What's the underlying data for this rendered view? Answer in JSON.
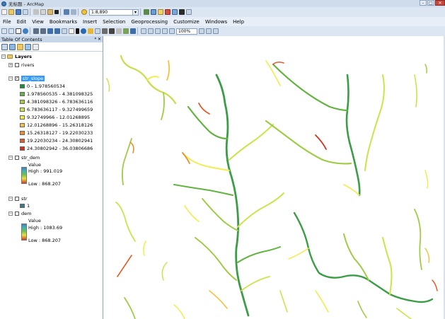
{
  "window": {
    "title": "无标题 - ArcMap"
  },
  "toolbar": {
    "scale": "1:8,890",
    "zoom": "100%"
  },
  "menu": [
    "File",
    "Edit",
    "View",
    "Bookmarks",
    "Insert",
    "Selection",
    "Geoprocessing",
    "Customize",
    "Windows",
    "Help"
  ],
  "toc": {
    "title": "Table Of Contents",
    "header_buttons": "ᵠ ✕",
    "layers_label": "Layers",
    "rivers": "rivers",
    "str_slope": "str_slope",
    "slope_classes": [
      {
        "label": "0 - 1.978560534",
        "color": "#1a8f3c"
      },
      {
        "label": "1.978560535 - 4.381098325",
        "color": "#62b33f"
      },
      {
        "label": "4.381098326 - 6.783636116",
        "color": "#9fcc44"
      },
      {
        "label": "6.783636117 - 9.327499659",
        "color": "#cde34a"
      },
      {
        "label": "9.32749966 - 12.01268895",
        "color": "#f0ee4e"
      },
      {
        "label": "12.01268896 - 15.26318126",
        "color": "#f4c23d"
      },
      {
        "label": "15.26318127 - 19.22030233",
        "color": "#ec8d2e"
      },
      {
        "label": "19.22030234 - 24.30802941",
        "color": "#e25a25"
      },
      {
        "label": "24.30802942 - 36.03806686",
        "color": "#d2321d"
      }
    ],
    "str_dem": "str_dem",
    "str_dem_value": "Value",
    "str_dem_high": "High : 991.019",
    "str_dem_low": "Low : 868.207",
    "str": "str",
    "str_class": "1",
    "dem": "dem",
    "dem_value": "Value",
    "dem_high": "High : 1083.69",
    "dem_low": "Low : 868.207"
  },
  "colors": {
    "str": "#3a7a8c"
  }
}
